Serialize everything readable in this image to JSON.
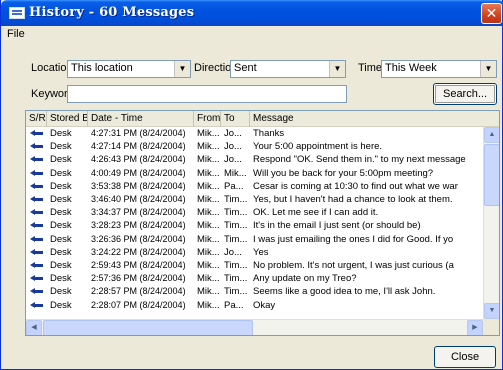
{
  "window": {
    "title": "History - 60 Messages",
    "close_glyph": "✕"
  },
  "menu": {
    "file": "File"
  },
  "filters": {
    "location_label": "Location",
    "location_value": "This location",
    "direction_label": "Direction",
    "direction_value": "Sent",
    "time_label": "Time",
    "time_value": "This Week",
    "keyword_label": "Keyword",
    "keyword_value": "",
    "search_button": "Search..."
  },
  "table": {
    "columns": [
      "S/R",
      "Stored By",
      "Date - Time",
      "From",
      "To",
      "Message"
    ],
    "rows": [
      {
        "icon": "sent-arrow-icon",
        "stored_by": "Desk",
        "datetime": "4:27:31 PM (8/24/2004)",
        "from": "Mik...",
        "to": "Jo...",
        "message": "Thanks"
      },
      {
        "icon": "sent-arrow-icon",
        "stored_by": "Desk",
        "datetime": "4:27:14 PM (8/24/2004)",
        "from": "Mik...",
        "to": "Jo...",
        "message": "Your 5:00 appointment is here."
      },
      {
        "icon": "sent-arrow-icon",
        "stored_by": "Desk",
        "datetime": "4:26:43 PM (8/24/2004)",
        "from": "Mik...",
        "to": "Jo...",
        "message": "Respond \"OK. Send them in.\" to my next message"
      },
      {
        "icon": "sent-arrow-icon",
        "stored_by": "Desk",
        "datetime": "4:00:49 PM (8/24/2004)",
        "from": "Mik...",
        "to": "Mik...",
        "message": "Will you be back for your 5:00pm meeting?"
      },
      {
        "icon": "sent-arrow-icon",
        "stored_by": "Desk",
        "datetime": "3:53:38 PM (8/24/2004)",
        "from": "Mik...",
        "to": "Pa...",
        "message": "Cesar is coming at 10:30 to find out what we war"
      },
      {
        "icon": "sent-arrow-icon",
        "stored_by": "Desk",
        "datetime": "3:46:40 PM (8/24/2004)",
        "from": "Mik...",
        "to": "Tim...",
        "message": "Yes, but I haven't had a chance to look at them."
      },
      {
        "icon": "sent-arrow-icon",
        "stored_by": "Desk",
        "datetime": "3:34:37 PM (8/24/2004)",
        "from": "Mik...",
        "to": "Tim...",
        "message": "OK.  Let me see if I can add it."
      },
      {
        "icon": "sent-arrow-icon",
        "stored_by": "Desk",
        "datetime": "3:28:23 PM (8/24/2004)",
        "from": "Mik...",
        "to": "Tim...",
        "message": "It's in the email I just sent (or should be)"
      },
      {
        "icon": "sent-arrow-icon",
        "stored_by": "Desk",
        "datetime": "3:26:36 PM (8/24/2004)",
        "from": "Mik...",
        "to": "Tim...",
        "message": "I was just emailing the ones I did for Good.  If yo"
      },
      {
        "icon": "sent-arrow-icon",
        "stored_by": "Desk",
        "datetime": "3:24:22 PM (8/24/2004)",
        "from": "Mik...",
        "to": "Jo...",
        "message": "Yes"
      },
      {
        "icon": "sent-arrow-icon",
        "stored_by": "Desk",
        "datetime": "2:59:43 PM (8/24/2004)",
        "from": "Mik...",
        "to": "Tim...",
        "message": "No problem.  It's not urgent, I was just curious (a"
      },
      {
        "icon": "sent-arrow-icon",
        "stored_by": "Desk",
        "datetime": "2:57:36 PM (8/24/2004)",
        "from": "Mik...",
        "to": "Tim...",
        "message": "Any update on my Treo?"
      },
      {
        "icon": "sent-arrow-icon",
        "stored_by": "Desk",
        "datetime": "2:28:57 PM (8/24/2004)",
        "from": "Mik...",
        "to": "Tim...",
        "message": "Seems like a good idea to me, I'll ask John."
      },
      {
        "icon": "sent-arrow-icon",
        "stored_by": "Desk",
        "datetime": "2:28:07 PM (8/24/2004)",
        "from": "Mik...",
        "to": "Pa...",
        "message": "Okay"
      }
    ]
  },
  "footer": {
    "close_button": "Close"
  }
}
